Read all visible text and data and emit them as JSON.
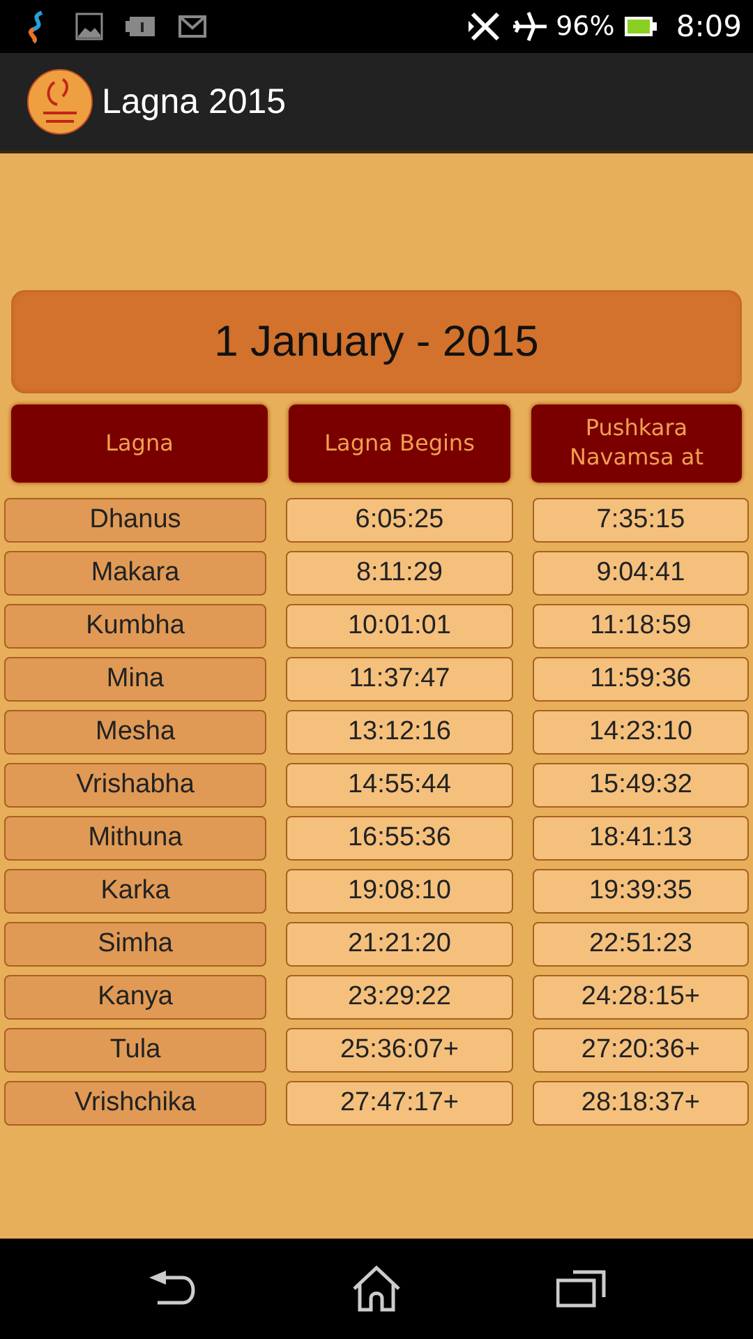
{
  "status_bar": {
    "battery": "96%",
    "time": "8:09"
  },
  "app_bar": {
    "title": "Lagna 2015"
  },
  "date_banner": "1 January - 2015",
  "table": {
    "columns": [
      "Lagna",
      "Lagna Begins",
      "Pushkara Navamsa at"
    ],
    "rows": [
      [
        "Dhanus",
        "6:05:25",
        "7:35:15"
      ],
      [
        "Makara",
        "8:11:29",
        "9:04:41"
      ],
      [
        "Kumbha",
        "10:01:01",
        "11:18:59"
      ],
      [
        "Mina",
        "11:37:47",
        "11:59:36"
      ],
      [
        "Mesha",
        "13:12:16",
        "14:23:10"
      ],
      [
        "Vrishabha",
        "14:55:44",
        "15:49:32"
      ],
      [
        "Mithuna",
        "16:55:36",
        "18:41:13"
      ],
      [
        "Karka",
        "19:08:10",
        "19:39:35"
      ],
      [
        "Simha",
        "21:21:20",
        "22:51:23"
      ],
      [
        "Kanya",
        "23:29:22",
        "24:28:15+"
      ],
      [
        "Tula",
        "25:36:07+",
        "27:20:36+"
      ],
      [
        "Vrishchika",
        "27:47:17+",
        "28:18:37+"
      ]
    ]
  }
}
